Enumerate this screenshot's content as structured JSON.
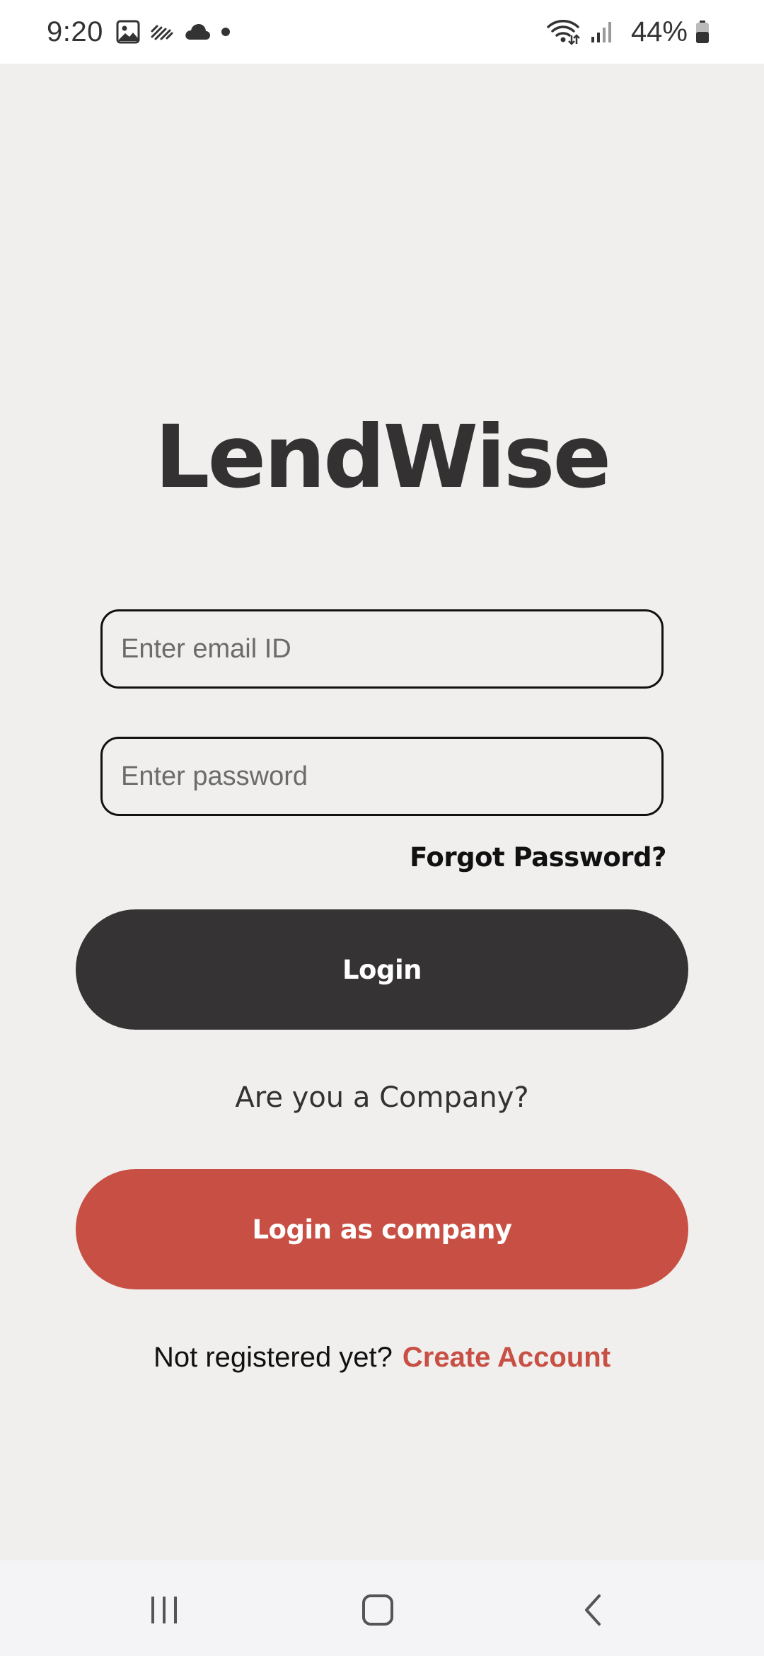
{
  "status_bar": {
    "time": "9:20",
    "battery": "44%",
    "icons": [
      "gallery-icon",
      "activity-icon",
      "cloud-icon",
      "dot-icon",
      "wifi-icon",
      "signal-icon",
      "battery-icon"
    ]
  },
  "app": {
    "title": "LendWise"
  },
  "form": {
    "email_placeholder": "Enter email ID",
    "email_value": "",
    "password_placeholder": "Enter password",
    "password_value": "",
    "forgot_label": "Forgot Password?",
    "login_label": "Login",
    "company_question": "Are you a Company?",
    "company_login_label": "Login as company",
    "register_prompt": "Not registered yet?",
    "register_link": "Create Account"
  },
  "colors": {
    "background": "#f0efee",
    "primary_dark": "#363334",
    "accent": "#c84f43"
  },
  "nav": {
    "icons": [
      "recents-icon",
      "home-icon",
      "back-icon"
    ]
  }
}
